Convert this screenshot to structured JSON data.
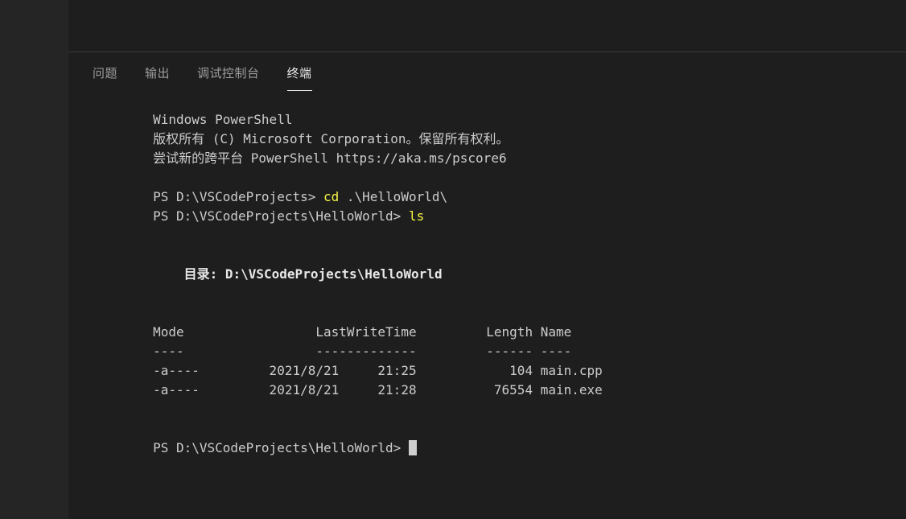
{
  "window": {
    "background_color": "#1e1e1e",
    "sidebar_color": "#252526"
  },
  "panel": {
    "tabs": [
      {
        "label": "问题",
        "active": false
      },
      {
        "label": "输出",
        "active": false
      },
      {
        "label": "调试控制台",
        "active": false
      },
      {
        "label": "终端",
        "active": true
      }
    ]
  },
  "terminal": {
    "foreground_color": "#cccccc",
    "command_color": "#f5f543",
    "cursor_color": "#cfcfcf",
    "lines": [
      {
        "id": "banner-title",
        "text": "Windows PowerShell"
      },
      {
        "id": "banner-copyright",
        "text": "版权所有 (C) Microsoft Corporation。保留所有权利。"
      },
      {
        "id": "banner-upsell",
        "text": "尝试新的跨平台 PowerShell https://aka.ms/pscore6"
      },
      {
        "id": "blank-1",
        "text": " "
      },
      {
        "id": "prompt-cd",
        "prompt": "PS D:\\VSCodeProjects> ",
        "command": "cd",
        "args": " .\\HelloWorld\\"
      },
      {
        "id": "prompt-ls",
        "prompt": "PS D:\\VSCodeProjects\\HelloWorld> ",
        "command": "ls",
        "args": ""
      },
      {
        "id": "blank-2",
        "text": " "
      },
      {
        "id": "blank-3",
        "text": " "
      },
      {
        "id": "directory-header",
        "text": "    目录: D:\\VSCodeProjects\\HelloWorld"
      },
      {
        "id": "blank-4",
        "text": " "
      },
      {
        "id": "blank-5",
        "text": " "
      },
      {
        "id": "table-header",
        "text": "Mode                 LastWriteTime         Length Name"
      },
      {
        "id": "table-rule",
        "text": "----                 -------------         ------ ----"
      },
      {
        "id": "row-main-cpp",
        "text": "-a----         2021/8/21     21:25            104 main.cpp"
      },
      {
        "id": "row-main-exe",
        "text": "-a----         2021/8/21     21:28          76554 main.exe"
      },
      {
        "id": "blank-6",
        "text": " "
      },
      {
        "id": "blank-7",
        "text": " "
      },
      {
        "id": "prompt-final",
        "prompt": "PS D:\\VSCodeProjects\\HelloWorld> ",
        "command": "",
        "args": "",
        "cursor": true
      }
    ],
    "table": {
      "columns": [
        "Mode",
        "LastWriteTime",
        "Length",
        "Name"
      ],
      "rows": [
        {
          "mode": "-a----",
          "date": "2021/8/21",
          "time": "21:25",
          "length": "104",
          "name": "main.cpp"
        },
        {
          "mode": "-a----",
          "date": "2021/8/21",
          "time": "21:28",
          "length": "76554",
          "name": "main.exe"
        }
      ]
    },
    "directory": "D:\\VSCodeProjects\\HelloWorld"
  }
}
